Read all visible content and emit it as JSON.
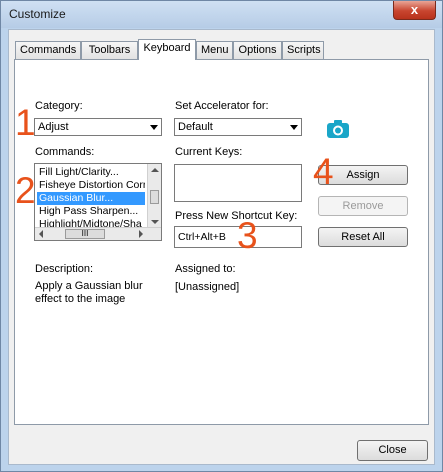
{
  "window": {
    "title": "Customize",
    "close_glyph": "x"
  },
  "tabs": [
    {
      "label": "Commands"
    },
    {
      "label": "Toolbars"
    },
    {
      "label": "Keyboard"
    },
    {
      "label": "Menu"
    },
    {
      "label": "Options"
    },
    {
      "label": "Scripts"
    }
  ],
  "active_tab": "Keyboard",
  "category": {
    "label": "Category:",
    "value": "Adjust"
  },
  "accelerator": {
    "label": "Set Accelerator for:",
    "value": "Default"
  },
  "commands": {
    "label": "Commands:",
    "items": [
      "Fill Light/Clarity...",
      "Fisheye Distortion Corr",
      "Gaussian Blur...",
      "High Pass Sharpen...",
      "Highlight/Midtone/Sha"
    ],
    "selected_index": 2,
    "hscroll_thumb": "III"
  },
  "current_keys": {
    "label": "Current Keys:"
  },
  "new_shortcut": {
    "label": "Press New Shortcut Key:",
    "value": "Ctrl+Alt+B"
  },
  "buttons": {
    "assign": "Assign",
    "remove": "Remove",
    "reset_all": "Reset All",
    "close": "Close"
  },
  "description": {
    "label": "Description:",
    "text": "Apply a Gaussian blur effect to the image"
  },
  "assigned_to": {
    "label": "Assigned to:",
    "value": "[Unassigned]"
  },
  "annotations": [
    "1",
    "2",
    "3",
    "4"
  ],
  "colors": {
    "annotation": "#e8521b",
    "camera_icon": "#1aa6c8",
    "selection": "#3399ff"
  },
  "icons": {
    "camera": "camera-icon"
  }
}
